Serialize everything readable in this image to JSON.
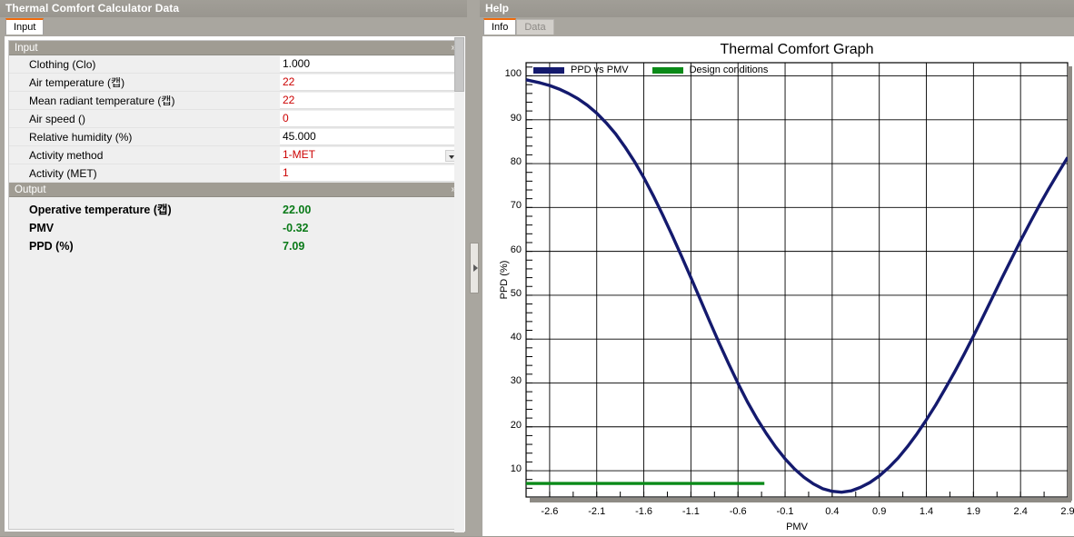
{
  "left": {
    "title": "Thermal Comfort Calculator Data",
    "tabs": [
      {
        "label": "Input",
        "active": true
      }
    ],
    "input_group": {
      "header": "Input",
      "chevron": "»",
      "rows": [
        {
          "label": "Clothing (Clo)",
          "value": "1.000",
          "color": "black",
          "combo": false
        },
        {
          "label": "Air temperature (캡)",
          "value": "22",
          "color": "red",
          "combo": false
        },
        {
          "label": "Mean radiant temperature (캡)",
          "value": "22",
          "color": "red",
          "combo": false
        },
        {
          "label": "Air speed ()",
          "value": "0",
          "color": "red",
          "combo": false
        },
        {
          "label": "Relative humidity (%)",
          "value": "45.000",
          "color": "black",
          "combo": false
        },
        {
          "label": "Activity method",
          "value": "1-MET",
          "color": "red",
          "combo": true
        },
        {
          "label": "Activity (MET)",
          "value": "1",
          "color": "red",
          "combo": false
        }
      ]
    },
    "output_group": {
      "header": "Output",
      "chevron": "»",
      "rows": [
        {
          "label": "Operative temperature (캡)",
          "value": "22.00"
        },
        {
          "label": "PMV",
          "value": "-0.32"
        },
        {
          "label": "PPD (%)",
          "value": "7.09"
        }
      ]
    }
  },
  "right": {
    "title": "Help",
    "tabs": [
      {
        "label": "Info",
        "active": true
      },
      {
        "label": "Data",
        "active": false
      }
    ]
  },
  "colors": {
    "accent_orange": "#f06a0a",
    "series_navy": "#141a6e",
    "series_green": "#0a8a18",
    "value_red": "#cc0000",
    "output_green": "#0a7a18",
    "window_chrome": "#a09c93"
  },
  "chart_data": {
    "type": "line",
    "title": "Thermal Comfort Graph",
    "xlabel": "PMV",
    "ylabel": "PPD (%)",
    "xlim": [
      -2.85,
      2.9
    ],
    "ylim": [
      4.0,
      103.0
    ],
    "grid": true,
    "legend_position": "top-left-inside",
    "xticks": [
      "-2.6",
      "-2.1",
      "-1.6",
      "-1.1",
      "-0.6",
      "-0.1",
      "0.4",
      "0.9",
      "1.4",
      "1.9",
      "2.4",
      "2.9"
    ],
    "xtick_values": [
      -2.6,
      -2.1,
      -1.6,
      -1.1,
      -0.6,
      -0.1,
      0.4,
      0.9,
      1.4,
      1.9,
      2.4,
      2.9
    ],
    "yticks": [
      "10",
      "20",
      "30",
      "40",
      "50",
      "60",
      "70",
      "80",
      "90",
      "100"
    ],
    "ytick_values": [
      10,
      20,
      30,
      40,
      50,
      60,
      70,
      80,
      90,
      100
    ],
    "series": [
      {
        "name": "PPD vs PMV",
        "color": "#141a6e",
        "x": [
          -2.85,
          -2.7,
          -2.6,
          -2.5,
          -2.4,
          -2.3,
          -2.2,
          -2.1,
          -2.0,
          -1.9,
          -1.8,
          -1.7,
          -1.6,
          -1.5,
          -1.4,
          -1.3,
          -1.2,
          -1.1,
          -1.0,
          -0.9,
          -0.8,
          -0.7,
          -0.6,
          -0.5,
          -0.4,
          -0.3,
          -0.2,
          -0.1,
          0.0,
          0.1,
          0.2,
          0.3,
          0.4,
          0.5,
          0.6,
          0.7,
          0.8,
          0.9,
          1.0,
          1.1,
          1.2,
          1.3,
          1.4,
          1.5,
          1.6,
          1.7,
          1.8,
          1.9,
          2.0,
          2.1,
          2.2,
          2.3,
          2.4,
          2.5,
          2.6,
          2.7,
          2.8,
          2.9
        ],
        "y": [
          99.1,
          98.4,
          97.8,
          97.0,
          96.0,
          94.8,
          93.3,
          91.5,
          89.3,
          86.8,
          83.8,
          80.5,
          76.8,
          72.7,
          68.3,
          63.7,
          58.9,
          54.0,
          49.0,
          44.0,
          39.1,
          34.4,
          29.9,
          25.7,
          21.9,
          18.5,
          15.4,
          12.7,
          10.4,
          8.5,
          7.0,
          5.9,
          5.3,
          5.1,
          5.4,
          6.2,
          7.3,
          8.8,
          10.7,
          12.9,
          15.5,
          18.4,
          21.6,
          25.0,
          28.7,
          32.5,
          36.5,
          40.7,
          45.0,
          49.4,
          53.8,
          58.1,
          62.4,
          66.5,
          70.5,
          74.3,
          77.9,
          81.4
        ]
      },
      {
        "name": "Design conditions",
        "color": "#0a8a18",
        "x": [
          -2.85,
          -0.32
        ],
        "y": [
          7.09,
          7.09
        ]
      }
    ],
    "design_point": {
      "pmv": -0.32,
      "ppd": 7.09
    }
  }
}
